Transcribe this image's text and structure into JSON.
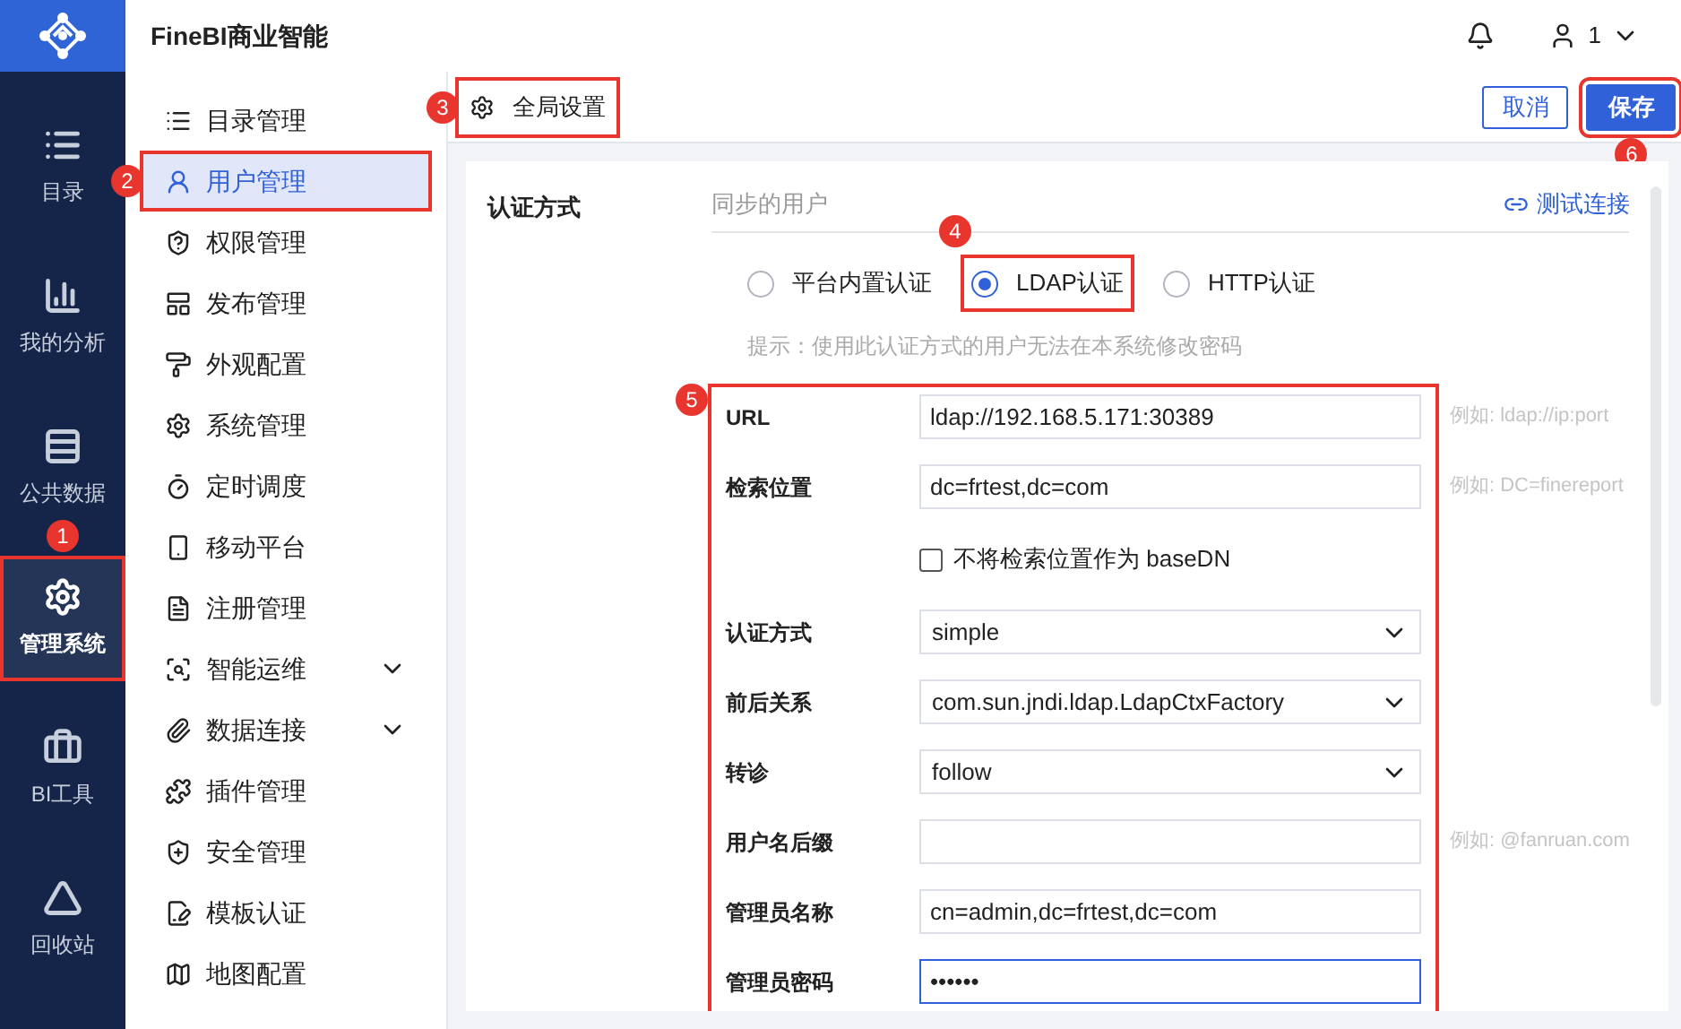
{
  "header": {
    "title": "FineBI商业智能",
    "user": "1"
  },
  "rail": [
    {
      "label": "目录",
      "selected": false
    },
    {
      "label": "我的分析",
      "selected": false
    },
    {
      "label": "公共数据",
      "selected": false
    },
    {
      "label": "管理系统",
      "selected": true,
      "marker": "1"
    },
    {
      "label": "BI工具",
      "selected": false
    },
    {
      "label": "回收站",
      "selected": false
    }
  ],
  "menu": [
    {
      "label": "目录管理",
      "selected": false
    },
    {
      "label": "用户管理",
      "selected": true,
      "marker": "2"
    },
    {
      "label": "权限管理",
      "selected": false
    },
    {
      "label": "发布管理",
      "selected": false
    },
    {
      "label": "外观配置",
      "selected": false
    },
    {
      "label": "系统管理",
      "selected": false
    },
    {
      "label": "定时调度",
      "selected": false
    },
    {
      "label": "移动平台",
      "selected": false
    },
    {
      "label": "注册管理",
      "selected": false
    },
    {
      "label": "智能运维",
      "selected": false,
      "expandable": true
    },
    {
      "label": "数据连接",
      "selected": false,
      "expandable": true
    },
    {
      "label": "插件管理",
      "selected": false
    },
    {
      "label": "安全管理",
      "selected": false
    },
    {
      "label": "模板认证",
      "selected": false
    },
    {
      "label": "地图配置",
      "selected": false
    }
  ],
  "toolbar": {
    "title": "全局设置",
    "marker": "3",
    "cancel": "取消",
    "save": "保存",
    "save_marker": "6"
  },
  "auth": {
    "label": "认证方式",
    "tab": "同步的用户",
    "test_link": "测试连接",
    "options": [
      {
        "label": "平台内置认证",
        "selected": false
      },
      {
        "label": "LDAP认证",
        "selected": true,
        "marker": "4"
      },
      {
        "label": "HTTP认证",
        "selected": false
      }
    ],
    "tip": "提示：使用此认证方式的用户无法在本系统修改密码"
  },
  "form": {
    "marker": "5",
    "fields": [
      {
        "kind": "input",
        "label": "URL",
        "value": "ldap://192.168.5.171:30389",
        "hint": "例如: ldap://ip:port"
      },
      {
        "kind": "input",
        "label": "检索位置",
        "value": "dc=frtest,dc=com",
        "hint": "例如: DC=finereport"
      },
      {
        "kind": "checkbox",
        "label": "不将检索位置作为 baseDN",
        "checked": false
      },
      {
        "kind": "select",
        "label": "认证方式",
        "value": "simple"
      },
      {
        "kind": "select",
        "label": "前后关系",
        "value": "com.sun.jndi.ldap.LdapCtxFactory"
      },
      {
        "kind": "select",
        "label": "转诊",
        "value": "follow"
      },
      {
        "kind": "input",
        "label": "用户名后缀",
        "hint": "例如: @fanruan.com"
      },
      {
        "kind": "input",
        "label": "管理员名称",
        "value": "cn=admin,dc=frtest,dc=com"
      },
      {
        "kind": "input",
        "label": "管理员密码",
        "value": "••••••",
        "focused": true
      }
    ]
  }
}
